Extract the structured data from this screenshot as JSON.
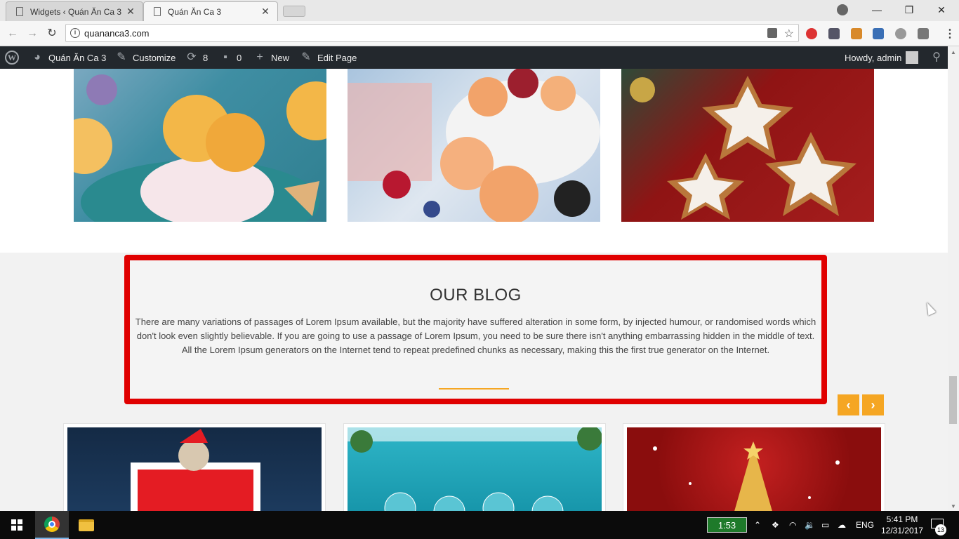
{
  "browser": {
    "tabs": [
      {
        "title": "Widgets ‹ Quán Ăn Ca 3",
        "close": "✕"
      },
      {
        "title": "Quán Ăn Ca 3",
        "close": "✕"
      }
    ],
    "url": "quananca3.com",
    "controls": {
      "minimize": "—",
      "maximize": "❐",
      "close": "✕"
    }
  },
  "adminbar": {
    "site_name": "Quán Ăn Ca 3",
    "customize": "Customize",
    "updates_count": "8",
    "comments_count": "0",
    "new_label": "New",
    "edit_page": "Edit Page",
    "greeting": "Howdy, admin"
  },
  "blog": {
    "heading": "OUR BLOG",
    "text": "There are many variations of passages of Lorem Ipsum available, but the majority have suffered alteration in some form, by injected humour, or randomised words which don't look even slightly believable. If you are going to use a passage of Lorem Ipsum, you need to be sure there isn't anything embarrassing hidden in the middle of text. All the Lorem Ipsum generators on the Internet tend to repeat predefined chunks as necessary, making this the first true generator on the Internet.",
    "prev_label": "‹",
    "next_label": "›"
  },
  "taskbar": {
    "timer": "1:53",
    "language": "ENG",
    "time": "5:41 PM",
    "date": "12/31/2017",
    "notifications": "13"
  },
  "colors": {
    "accent": "#f5a623",
    "highlight_border": "#e00000",
    "adminbar": "#23282d"
  }
}
